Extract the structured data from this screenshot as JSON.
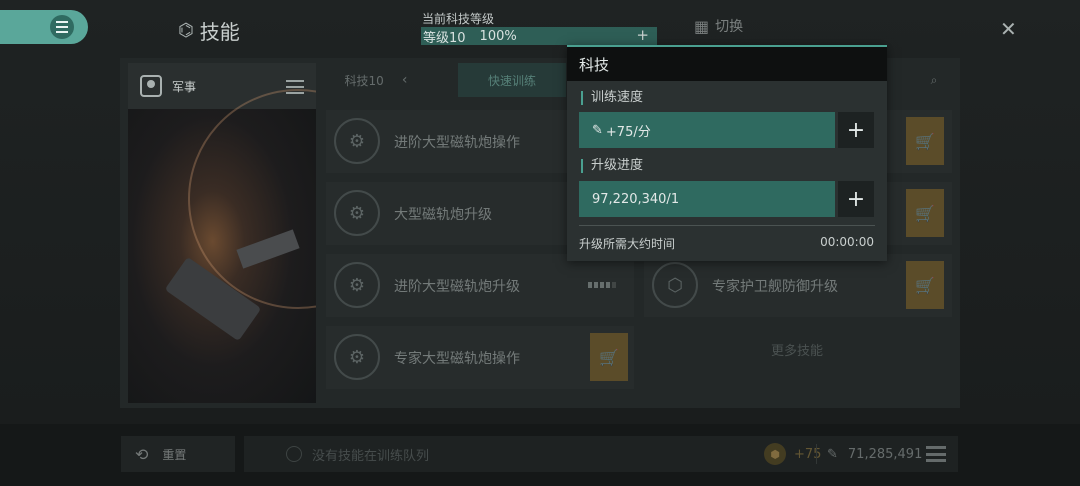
{
  "header": {
    "title": "技能",
    "tech_level_label": "当前科技等级",
    "tech_level_value": "等级10",
    "tech_level_percent": "100%",
    "tech_level_progress": 1.0,
    "switch_label": "切换"
  },
  "left_panel": {
    "category": "军事"
  },
  "tabs": {
    "tech_tab": "科技10",
    "quick_train": "快速训练"
  },
  "skills_left": [
    {
      "name": "进阶大型磁轨炮操作"
    },
    {
      "name": "大型磁轨炮升级"
    },
    {
      "name": "进阶大型磁轨炮升级",
      "progress_segments_filled": 4,
      "progress_segments_total": 5
    },
    {
      "name": "专家大型磁轨炮操作"
    }
  ],
  "skills_right": [
    {
      "name": ""
    },
    {
      "name": ""
    },
    {
      "name": "专家护卫舰防御升级"
    }
  ],
  "more_skills": "更多技能",
  "popup": {
    "title": "科技",
    "train_speed_label": "训练速度",
    "train_speed_value": "+75/分",
    "upgrade_progress_label": "升级进度",
    "upgrade_progress_value": "97,220,340/1",
    "estimate_label": "升级所需大约时间",
    "estimate_value": "00:00:00",
    "plus": "+"
  },
  "bottom": {
    "reset_label": "重置",
    "queue_empty": "没有技能在训练队列",
    "boost_value": "+75",
    "skill_points": "71,285,491"
  },
  "colors": {
    "accent": "#5aa79a",
    "field": "#2f6a60",
    "cart": "#8a6a2a"
  }
}
